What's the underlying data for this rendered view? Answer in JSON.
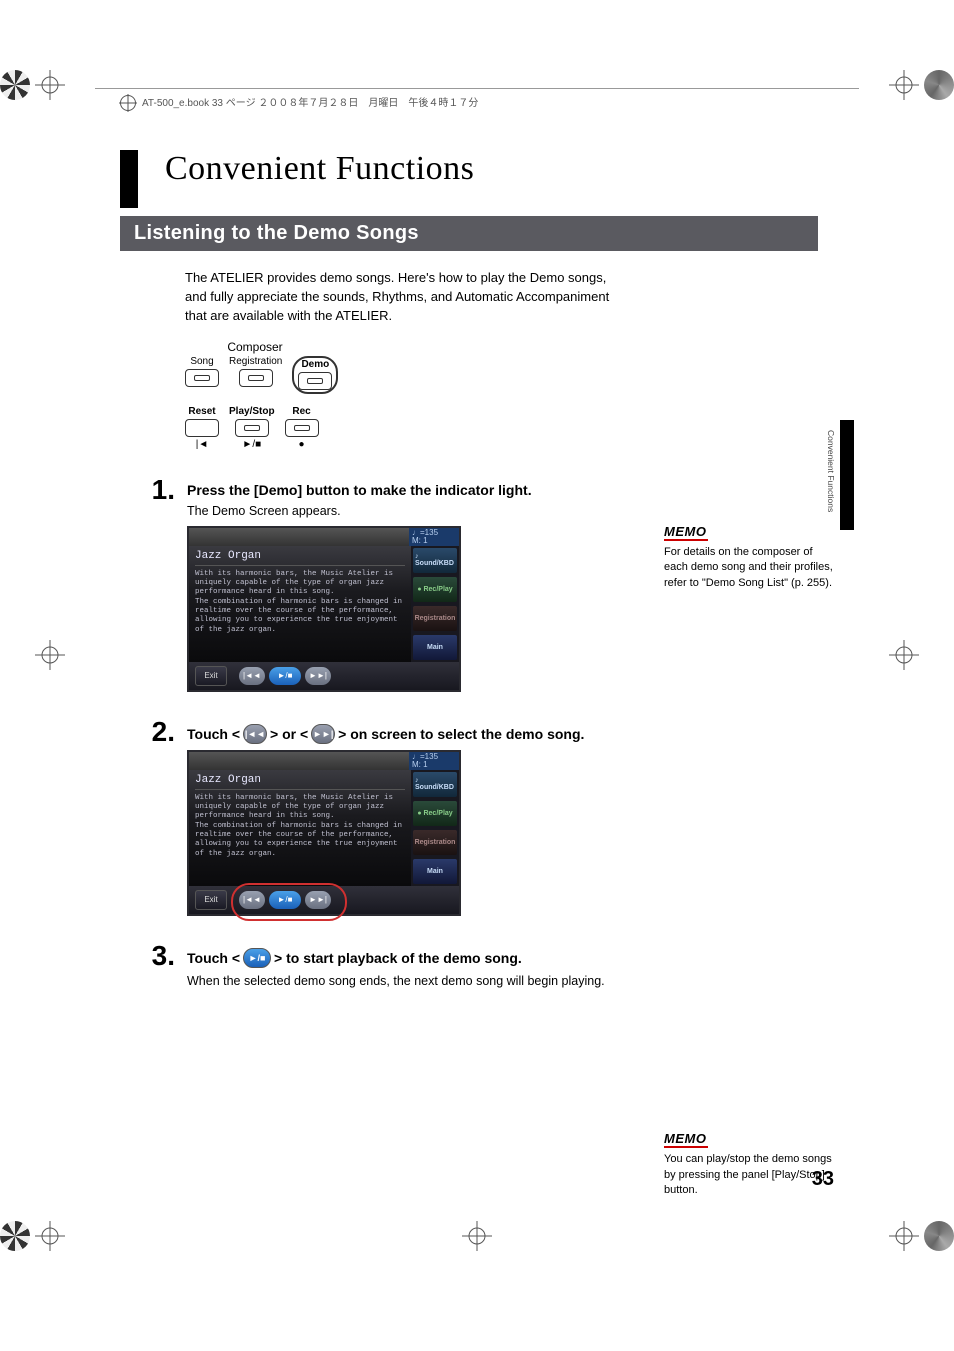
{
  "docline": "AT-500_e.book  33 ページ  ２００８年７月２８日　月曜日　午後４時１７分",
  "chapter_title": "Convenient Functions",
  "section_title": "Listening to the Demo Songs",
  "intro": "The ATELIER provides demo songs. Here's how to play the Demo songs, and fully appreciate the sounds, Rhythms, and Automatic Accompaniment that are available with the ATELIER.",
  "panel": {
    "group_label": "Composer",
    "buttons_top": [
      "Song",
      "Registration",
      "Demo"
    ],
    "buttons_bottom_labels": [
      "Reset",
      "Play/Stop",
      "Rec"
    ],
    "transport_symbols": [
      "|◄",
      "►/■",
      "●"
    ]
  },
  "steps": [
    {
      "num": "1.",
      "heading_parts": [
        "Press the [Demo] button to make the indicator light."
      ],
      "subtext": "The Demo Screen appears.",
      "screen": true
    },
    {
      "num": "2.",
      "heading_parts": [
        "Touch < ",
        {
          "icon": "prev"
        },
        " > or < ",
        {
          "icon": "next"
        },
        " > on screen to select the demo song."
      ],
      "subtext": "",
      "screen": true,
      "highlight_transport": true
    },
    {
      "num": "3.",
      "heading_parts": [
        "Touch < ",
        {
          "icon": "play"
        },
        " > to start playback of the demo song."
      ],
      "subtext": "When the selected demo song ends, the next demo song will begin playing.",
      "screen": false
    }
  ],
  "demo_screen": {
    "tempo": "♩=135",
    "measure": "M:     1",
    "title": "Jazz Organ",
    "desc": "With its harmonic bars, the Music Atelier is uniquely capable of the type of organ jazz performance heard in this song.\nThe combination of harmonic bars is changed in realtime over the course of the performance, allowing you to experience the true enjoyment of the jazz organ.",
    "side_buttons": [
      "Sound/KBD",
      "Rec/Play",
      "Registration",
      "Main"
    ],
    "footer_exit": "Exit"
  },
  "memos": [
    {
      "label": "MEMO",
      "text": "For details on the composer of each demo song and their profiles, refer to \"Demo Song List\" (p. 255)."
    },
    {
      "label": "MEMO",
      "text": "You can play/stop the demo songs by pressing the panel [Play/Stop] button."
    }
  ],
  "side_tab_label": "Convenient Functions",
  "page_number": "33"
}
